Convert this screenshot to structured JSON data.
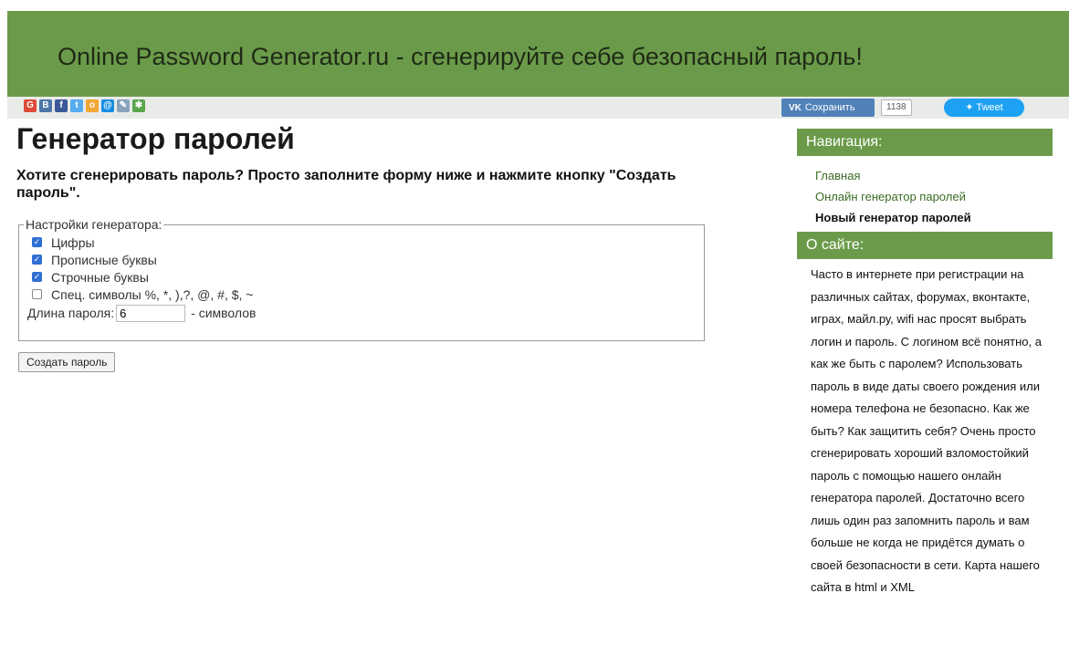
{
  "header": {
    "title": "Online Password Generator.ru - сгенерируйте себе безопасный пароль!"
  },
  "share": {
    "icons": [
      {
        "name": "google-plus-icon",
        "glyph": "G",
        "color": "#dd4b39"
      },
      {
        "name": "vk-icon",
        "glyph": "B",
        "color": "#4a76a8"
      },
      {
        "name": "facebook-icon",
        "glyph": "f",
        "color": "#3b5998"
      },
      {
        "name": "twitter-icon",
        "glyph": "t",
        "color": "#55acee"
      },
      {
        "name": "odnoklassniki-icon",
        "glyph": "o",
        "color": "#f2a634"
      },
      {
        "name": "mailru-icon",
        "glyph": "@",
        "color": "#168de2"
      },
      {
        "name": "livejournal-icon",
        "glyph": "✎",
        "color": "#8aa3bb"
      },
      {
        "name": "moikrug-icon",
        "glyph": "✱",
        "color": "#5aa54b"
      }
    ],
    "vk_save": "Сохранить",
    "vk_count": "1138",
    "tweet": "Tweet"
  },
  "main": {
    "title": "Генератор паролей",
    "lead": "Хотите сгенерировать пароль? Просто заполните форму ниже и нажмите кнопку \"Создать пароль\".",
    "settings": {
      "legend": "Настройки генератора:",
      "options": [
        {
          "label": "Цифры",
          "checked": true
        },
        {
          "label": "Прописные буквы",
          "checked": true
        },
        {
          "label": "Строчные буквы",
          "checked": true
        },
        {
          "label": "Спец. символы %, *, ),?, @, #, $, ~",
          "checked": false
        }
      ],
      "length_label": "Длина пароля:",
      "length_value": "6",
      "length_suffix": "- символов"
    },
    "create_button": "Создать пароль"
  },
  "sidebar": {
    "nav_title": "Навигация:",
    "nav_items": [
      {
        "label": "Главная",
        "active": false
      },
      {
        "label": "Онлайн генератор паролей",
        "active": false
      },
      {
        "label": "Новый генератор паролей",
        "active": true
      }
    ],
    "about_title": "О сайте:",
    "about_text": "Часто в интернете при регистрации на различных сайтах, форумах, вконтакте, играх, майл.ру, wifi нас просят выбрать логин и пароль. С логином всё понятно, а как же быть с паролем? Использовать пароль в виде даты своего рождения или номера телефона не безопасно. Как же быть? Как защитить себя? Очень просто сгенерировать хороший взломостойкий пароль с помощью нашего онлайн генератора паролей. Достаточно всего лишь один раз запомнить пароль и вам больше не когда не придётся думать о своей безопасности в сети. Карта нашего сайта в html и XML"
  },
  "colors": {
    "brand_green": "#6b9b4a",
    "checkbox_blue": "#2f6fd3"
  }
}
